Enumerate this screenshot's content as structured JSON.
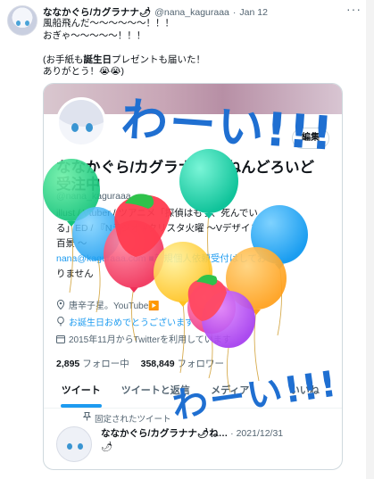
{
  "tweet": {
    "author_name": "ななかぐら/カグラナナ🌶",
    "author_handle": "@nana_kaguraaa",
    "separator": "·",
    "date": "Jan 12",
    "more": "···",
    "lines": [
      "風船飛んだ〜〜〜〜〜〜！！！",
      "おぎゃ〜〜〜〜〜！！！",
      "",
      "(お手紙も誕生日プレゼントも届いた！",
      "ありがとう！😭😭)"
    ],
    "line4_prefix": "(お手紙も",
    "line4_bold": "誕生日",
    "line4_suffix": "プレゼントも届いた！"
  },
  "card": {
    "follow_label": "編集",
    "profile_name": "ななかぐら/カグラナナ🌶ねんどろいど",
    "profile_name2": "受注中",
    "profile_handle": "@nana_kaguraaa",
    "bio": [
      "illust / Vtuber / ツアニメ「探偵はもう、死んでい",
      "る」ED / 『Nラジオ #クリスタ火曜 〜Vデザイン', '百景', ' 〜', 'nana@kaguraaa.com ■新規個人依頼受付はしてお",
      "りません"
    ],
    "bio_lines": [
      "illust / Vtuber / ツアニメ「探偵はもう、死んでい",
      "る」ED / 『Nラジオ #クリスタ火曜 〜Vデザイン",
      "百景 〜",
      "nana@kaguraaa.com ■新規個人依頼受付はしてお",
      "りません"
    ],
    "location": "唐辛子星。YouTube▶️",
    "birthday": "お誕生日おめでとうございます",
    "joined": "2015年11月からTwitterを利用しています",
    "following_count": "2,895",
    "following_label": "フォロー中",
    "followers_count": "358,849",
    "followers_label": "フォロワー",
    "tabs": [
      "ツイート",
      "ツイートと返信",
      "メディア",
      "いいね"
    ],
    "pinned_label": "固定されたツイート",
    "pinned_name": "ななかぐら/カグラナナ🌶ね…",
    "pinned_date": "· 2021/12/31",
    "pinned_more": "···",
    "pinned_text": "🌶"
  },
  "overlay": {
    "wa_top": "わーい!!!",
    "wa_bottom": "わーい!!!"
  },
  "icons": {
    "location": "location-pin-icon",
    "birthday": "balloon-icon",
    "joined": "calendar-icon",
    "pin": "pin-icon"
  },
  "colors": {
    "accent": "#1d9bf0",
    "text": "#0f1419",
    "muted": "#536471",
    "handwriting": "#1f6fd1"
  }
}
